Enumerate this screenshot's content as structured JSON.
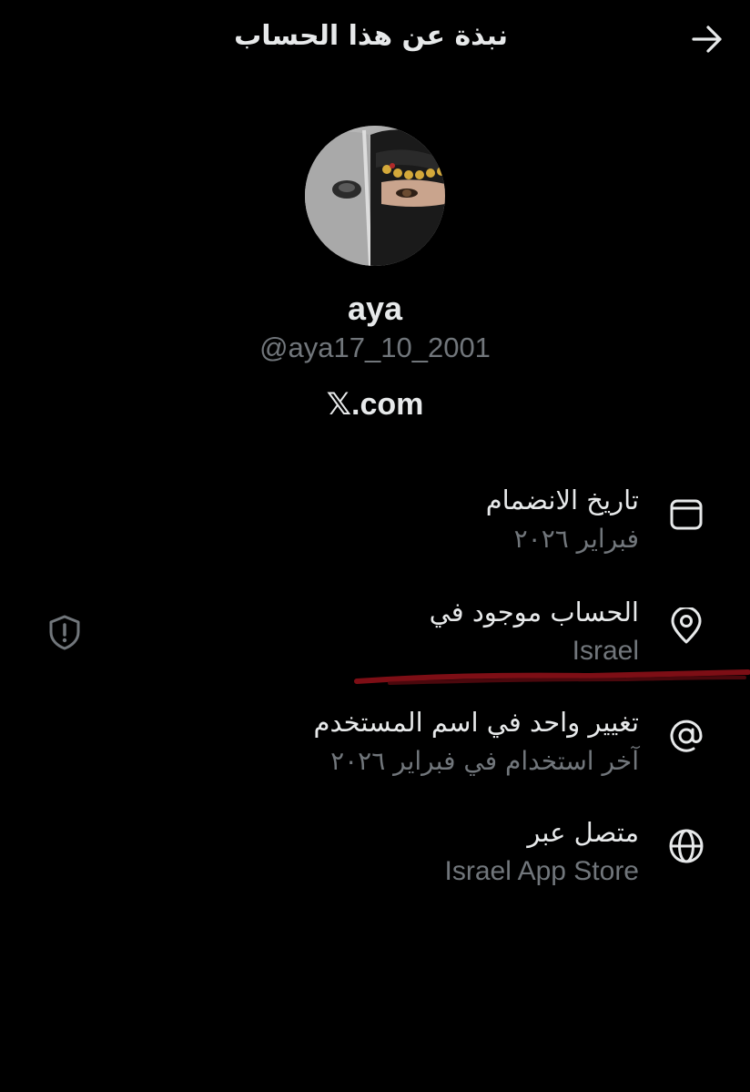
{
  "header": {
    "title": "نبذة عن هذا الحساب",
    "back_icon": "arrow-right-icon"
  },
  "profile": {
    "display_name": "aya",
    "handle": "@aya17_10_2001",
    "site_mark": "𝕏",
    "site_suffix": ".com"
  },
  "about_rows": [
    {
      "icon": "calendar-icon",
      "title": "تاريخ الانضمام",
      "subtitle": "فبراير ٢٠٢٦"
    },
    {
      "icon": "location-pin-icon",
      "title": "الحساب موجود في",
      "subtitle": "Israel",
      "extra_icon": "shield-alert-icon"
    },
    {
      "icon": "at-sign-icon",
      "title": "تغيير واحد في اسم المستخدم",
      "subtitle": "آخر استخدام في فبراير ٢٠٢٦"
    },
    {
      "icon": "globe-icon",
      "title": "متصل عبر",
      "subtitle": "Israel App Store"
    }
  ],
  "colors": {
    "background": "#000000",
    "primary_text": "#e7e9ea",
    "secondary_text": "#71767b",
    "highlight_mark": "#8b0f17"
  }
}
